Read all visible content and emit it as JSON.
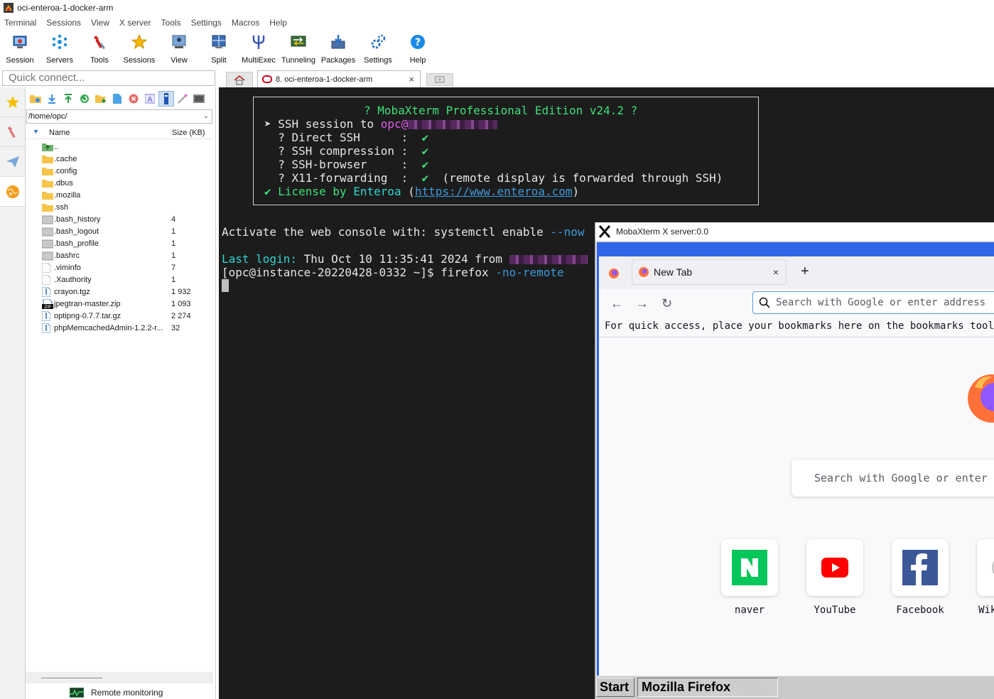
{
  "window": {
    "title": "oci-enteroa-1-docker-arm"
  },
  "menu": [
    "Terminal",
    "Sessions",
    "View",
    "X server",
    "Tools",
    "Settings",
    "Macros",
    "Help"
  ],
  "toolbar": [
    {
      "label": "Session",
      "icon": "session-icon"
    },
    {
      "label": "Servers",
      "icon": "servers-icon"
    },
    {
      "label": "Tools",
      "icon": "tools-icon"
    },
    {
      "label": "Sessions",
      "icon": "sessions-star-icon"
    },
    {
      "label": "View",
      "icon": "view-icon"
    },
    {
      "label": "Split",
      "icon": "split-icon"
    },
    {
      "label": "MultiExec",
      "icon": "multiexec-icon"
    },
    {
      "label": "Tunneling",
      "icon": "tunneling-icon"
    },
    {
      "label": "Packages",
      "icon": "packages-icon"
    },
    {
      "label": "Settings",
      "icon": "settings-icon"
    },
    {
      "label": "Help",
      "icon": "help-icon"
    }
  ],
  "quick_connect": {
    "placeholder": "Quick connect..."
  },
  "tabs": {
    "active_label": "8. oci-enteroa-1-docker-arm",
    "close": "×"
  },
  "sftp": {
    "path": "/home/opc/",
    "col_name": "Name",
    "col_size": "Size (KB)",
    "files": [
      {
        "name": "..",
        "size": "",
        "kind": "up"
      },
      {
        "name": ".cache",
        "size": "",
        "kind": "folder"
      },
      {
        "name": ".config",
        "size": "",
        "kind": "folder"
      },
      {
        "name": ".dbus",
        "size": "",
        "kind": "folder"
      },
      {
        "name": ".mozilla",
        "size": "",
        "kind": "folder"
      },
      {
        "name": ".ssh",
        "size": "",
        "kind": "folder"
      },
      {
        "name": ".bash_history",
        "size": "4",
        "kind": "file-gray"
      },
      {
        "name": ".bash_logout",
        "size": "1",
        "kind": "file-gray"
      },
      {
        "name": ".bash_profile",
        "size": "1",
        "kind": "file-gray"
      },
      {
        "name": ".bashrc",
        "size": "1",
        "kind": "file-gray"
      },
      {
        "name": ".viminfo",
        "size": "7",
        "kind": "file"
      },
      {
        "name": ".Xauthority",
        "size": "1",
        "kind": "file"
      },
      {
        "name": "crayon.tgz",
        "size": "1 932",
        "kind": "archive"
      },
      {
        "name": "jpegtran-master.zip",
        "size": "1 093",
        "kind": "zip"
      },
      {
        "name": "optipng-0.7.7.tar.gz",
        "size": "2 274",
        "kind": "archive"
      },
      {
        "name": "phpMemcachedAdmin-1.2.2-r...",
        "size": "32",
        "kind": "archive"
      }
    ],
    "remote_monitoring": "Remote monitoring"
  },
  "terminal": {
    "banner_title": "? MobaXterm Professional Edition v24.2 ?",
    "ssh_prefix": "➤ SSH session to ",
    "ssh_user": "opc@",
    "direct_ssh": "  ? Direct SSH      :",
    "compression": "  ? SSH compression :",
    "browser": "  ? SSH-browser     :",
    "x11": "  ? X11-forwarding  :",
    "check": "✔",
    "x11_note": "(remote display is forwarded through SSH)",
    "license_prefix": "✔ License by ",
    "license_name": "Enteroa",
    "license_url": "https://www.enteroa.com",
    "activate": "Activate the web console with: systemctl enable",
    "activate_opt": "--now",
    "last_login_label": "Last login:",
    "last_login_value": "Thu Oct 10 11:35:41 2024 from",
    "prompt": "[opc@instance-20220428-0332 ~]$ firefox",
    "prompt_opt": "-no-remote"
  },
  "xserver": {
    "title": "MobaXterm X server:0.0",
    "firefox": {
      "tab_label": "New Tab",
      "tab_close": "×",
      "new_tab": "+",
      "url_placeholder": "Search with Google or enter address",
      "bookmarks_hint": "For quick access, place your bookmarks here on the bookmarks toolbar.",
      "search_placeholder": "Search with Google or enter address",
      "sites": [
        {
          "label": "naver",
          "color": "#03c75a"
        },
        {
          "label": "YouTube",
          "color": "#ff0000"
        },
        {
          "label": "Facebook",
          "color": "#3b5998"
        },
        {
          "label": "Wikipedia",
          "color": "#888888"
        }
      ]
    },
    "taskbar": {
      "start": "Start",
      "task": "Mozilla Firefox"
    }
  }
}
